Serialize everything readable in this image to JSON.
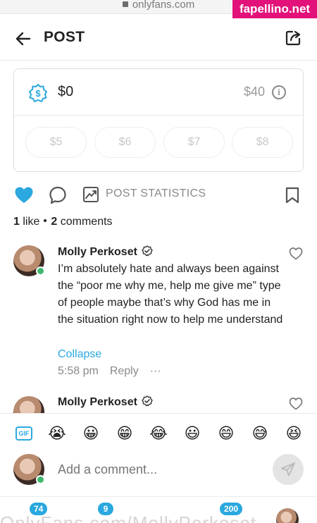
{
  "browser": {
    "url": "onlyfans.com",
    "watermark": "fapellino.net"
  },
  "header": {
    "title": "POST"
  },
  "tip": {
    "current": "$0",
    "max": "$40",
    "presets": [
      "$5",
      "$6",
      "$7",
      "$8"
    ]
  },
  "actions": {
    "stats_label": "POST STATISTICS"
  },
  "counts": {
    "likes_num": "1",
    "likes_word": "like",
    "comments_num": "2",
    "comments_word": "comments"
  },
  "comments": [
    {
      "name": "Molly Perkoset",
      "text": "I’m absolutely hate and always been against the “poor me why me, help me give me” type of people maybe that’s why God has me in the situation right now to help me understand",
      "collapse": "Collapse",
      "time": "5:58 pm",
      "reply": "Reply",
      "more": "···"
    },
    {
      "name": "Molly Perkoset"
    }
  ],
  "emojis": [
    "😭",
    "😀",
    "😁",
    "😂",
    "😃",
    "😄",
    "😅",
    "😆"
  ],
  "composer": {
    "placeholder": "Add a comment..."
  },
  "bottom": {
    "badges": [
      "74",
      "9",
      "200"
    ],
    "ghost_text": "OnlyFans.com/MollyPerkoset"
  },
  "colors": {
    "accent": "#2aa8df",
    "online": "#3db76e",
    "watermark": "#e2127a"
  }
}
